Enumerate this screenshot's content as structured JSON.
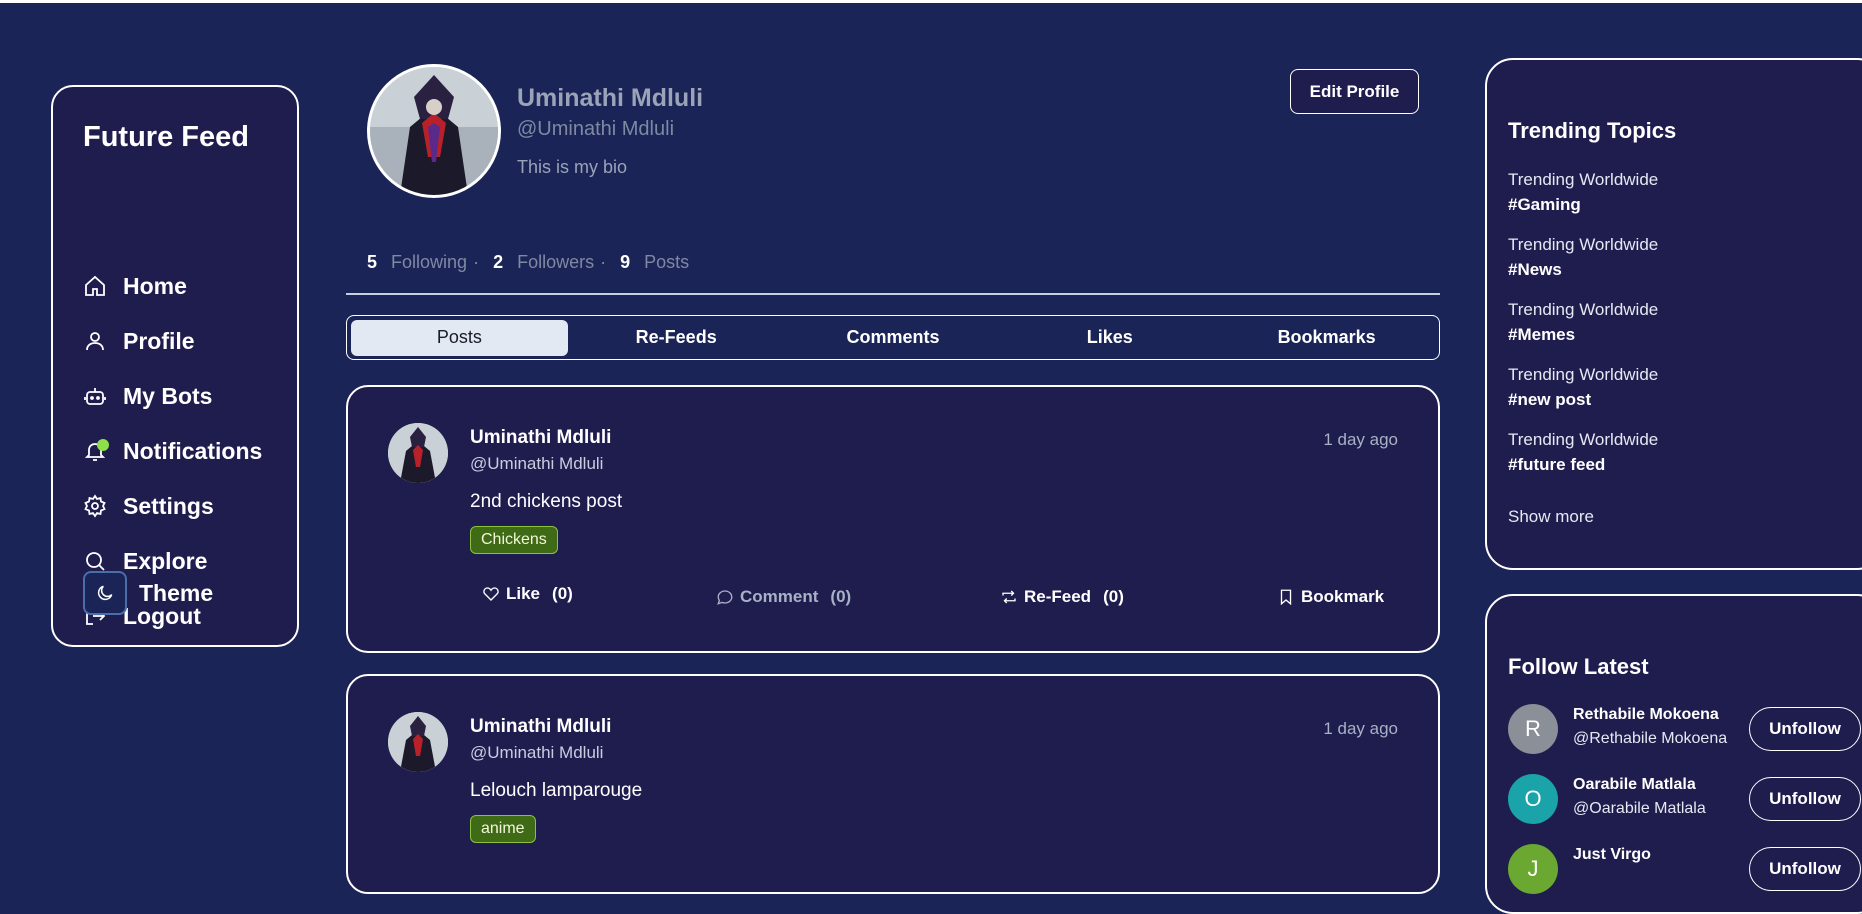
{
  "brand": "Future Feed",
  "nav": {
    "home": "Home",
    "profile": "Profile",
    "bots": "My Bots",
    "notifications": "Notifications",
    "settings": "Settings",
    "explore": "Explore",
    "logout": "Logout",
    "theme": "Theme"
  },
  "profile": {
    "name": "Uminathi Mdluli",
    "handle": "@Uminathi Mdluli",
    "bio": "This is my bio",
    "edit_label": "Edit Profile",
    "following_count": "5",
    "following_label": "Following",
    "followers_count": "2",
    "followers_label": "Followers",
    "posts_count": "9",
    "posts_label": "Posts",
    "separator": "·"
  },
  "tabs": [
    "Posts",
    "Re-Feeds",
    "Comments",
    "Likes",
    "Bookmarks"
  ],
  "active_tab": "Posts",
  "posts": [
    {
      "name": "Uminathi Mdluli",
      "handle": "@Uminathi Mdluli",
      "time": "1 day ago",
      "text": "2nd chickens post",
      "tag": "Chickens",
      "like_label": "Like",
      "like_count": "(0)",
      "comment_label": "Comment",
      "comment_count": "(0)",
      "refeed_label": "Re-Feed",
      "refeed_count": "(0)",
      "bookmark_label": "Bookmark"
    },
    {
      "name": "Uminathi Mdluli",
      "handle": "@Uminathi Mdluli",
      "time": "1 day ago",
      "text": "Lelouch lamparouge",
      "tag": "anime"
    }
  ],
  "trending": {
    "title": "Trending Topics",
    "items": [
      {
        "meta": "Trending Worldwide",
        "tag": "#Gaming"
      },
      {
        "meta": "Trending Worldwide",
        "tag": "#News"
      },
      {
        "meta": "Trending Worldwide",
        "tag": "#Memes"
      },
      {
        "meta": "Trending Worldwide",
        "tag": "#new post"
      },
      {
        "meta": "Trending Worldwide",
        "tag": "#future feed"
      }
    ],
    "show_more": "Show more"
  },
  "follow_latest": {
    "title": "Follow Latest",
    "users": [
      {
        "initial": "R",
        "name": "Rethabile Mokoena",
        "handle": "@Rethabile Mokoena",
        "button": "Unfollow",
        "color": "#8a8f98"
      },
      {
        "initial": "O",
        "name": "Oarabile Matlala",
        "handle": "@Oarabile Matlala",
        "button": "Unfollow",
        "color": "#1aa3a8"
      },
      {
        "initial": "J",
        "name": "Just Virgo",
        "handle": "",
        "button": "Unfollow",
        "color": "#6aa832"
      }
    ]
  },
  "colors": {
    "background": "#1a2456",
    "card": "#1f1c4e",
    "tag_bg": "#3f6a16",
    "notification_dot": "#8ee04a"
  }
}
